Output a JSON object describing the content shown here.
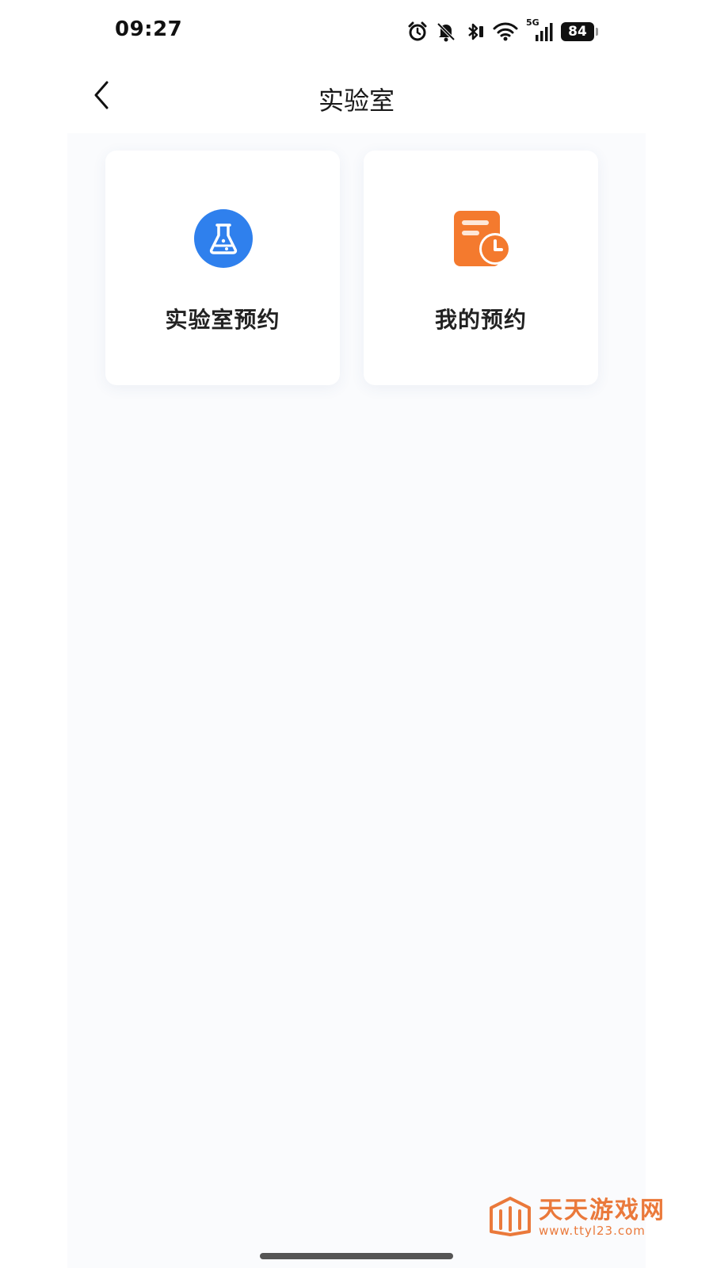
{
  "status_bar": {
    "time": "09:27",
    "network": "5G",
    "battery": "84",
    "icons": [
      "alarm-icon",
      "bell-off-icon",
      "bluetooth-icon",
      "wifi-icon",
      "cellular-signal-icon",
      "battery-icon"
    ]
  },
  "nav": {
    "title": "实验室",
    "back_icon": "chevron-left-icon"
  },
  "cards": [
    {
      "label": "实验室预约",
      "icon": "flask-icon",
      "icon_color": "#2f80ed"
    },
    {
      "label": "我的预约",
      "icon": "schedule-doc-icon",
      "icon_color": "#f47a2e"
    }
  ],
  "watermark": {
    "title": "天天游戏网",
    "url": "www.ttyl23.com",
    "color": "#e8631a"
  },
  "colors": {
    "content_bg": "#fafbfd",
    "card_bg": "#ffffff"
  }
}
